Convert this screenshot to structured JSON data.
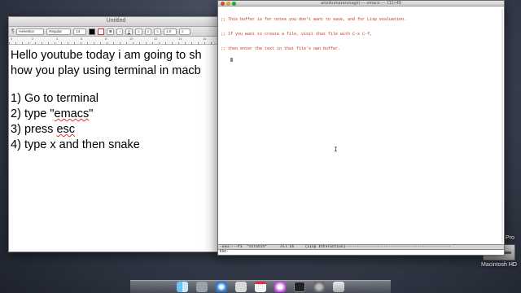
{
  "textedit": {
    "title": "Untitled",
    "toolbar": {
      "style": "Helvetica",
      "typeface": "Regular",
      "size": "14",
      "spacing": "1.0",
      "lists": "≡"
    },
    "ruler_numbers": [
      "0",
      "2",
      "4",
      "6",
      "8",
      "10",
      "12",
      "14",
      "16"
    ],
    "lines": [
      "Hello youtube today i am going to sh",
      "how you play using terminal in macb"
    ],
    "steps": [
      {
        "num": "1)",
        "text": "Go to terminal"
      },
      {
        "num": "2)",
        "pre": "type \"",
        "spell": "emacs",
        "post": "\""
      },
      {
        "num": "3)",
        "pre": "press ",
        "spell": "esc",
        "post": ""
      },
      {
        "num": "4)",
        "text": "type x and then snake"
      }
    ]
  },
  "terminal": {
    "title": "arunkumararunagiri — emacs — 111×49",
    "buffer_lines": [
      ";; This buffer is for notes you don't want to save, and for Lisp evaluation.",
      ";; If you want to create a file, visit that file with C-x C-f,",
      ";; then enter the text in that file's own buffer."
    ],
    "modeline": "-uuu:---F1  *scratch*      All L5     (Lisp Interaction)-----------------------------------------------",
    "minibuffer": "ESC-"
  },
  "desktop": {
    "hd_label": "Macintosh HD",
    "hd_partial": "Pro"
  },
  "colors": {
    "emacs_comment": "#c5301b",
    "close": "#e0443e",
    "minimize": "#dea123",
    "zoom": "#1aab29"
  }
}
